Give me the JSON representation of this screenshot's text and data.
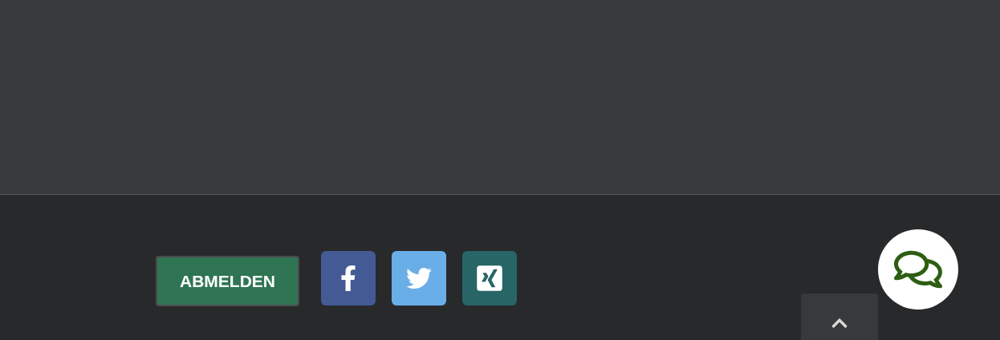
{
  "newsletter": {
    "unsubscribe_button": {
      "label": "ABMELDEN"
    }
  }
}
